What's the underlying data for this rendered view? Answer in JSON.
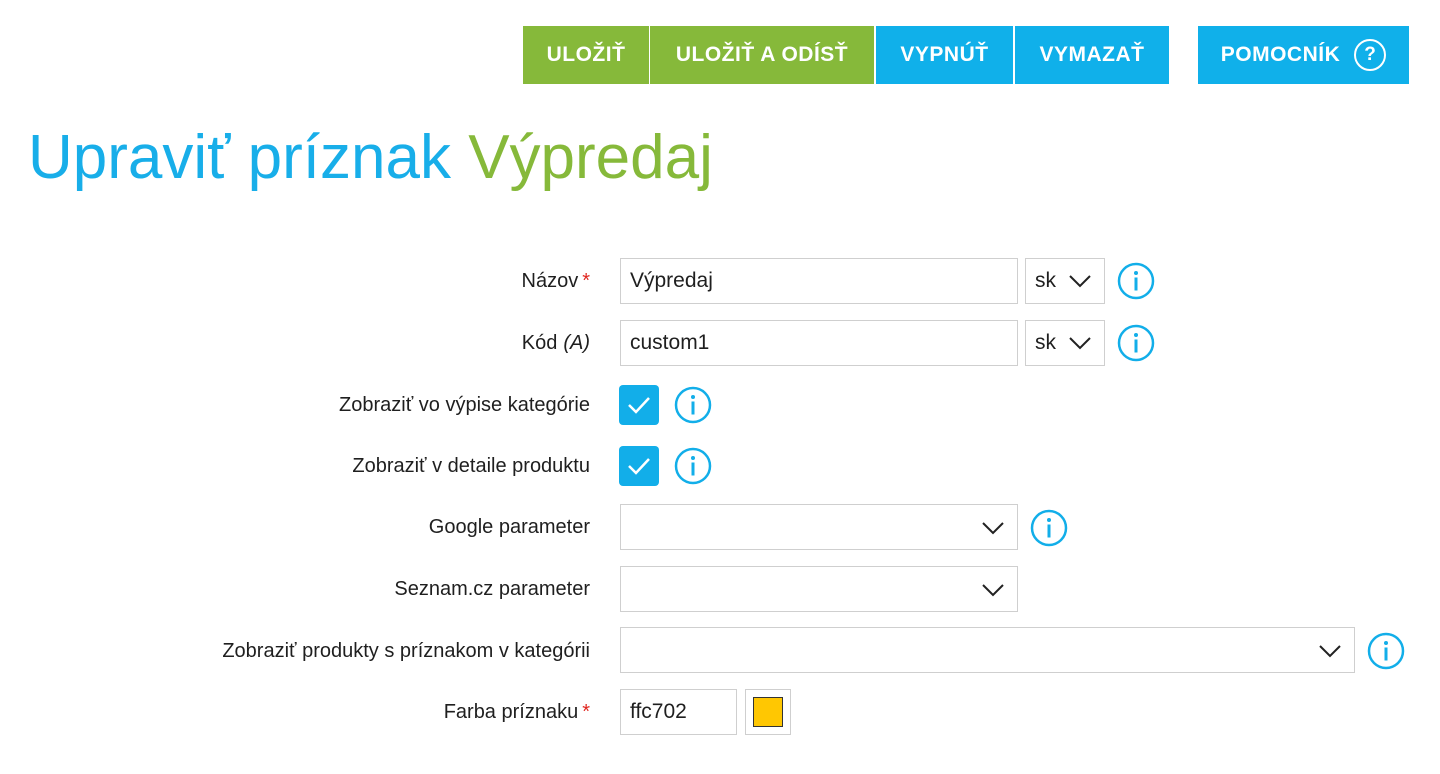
{
  "toolbar": {
    "save_label": "ULOŽIŤ",
    "save_exit_label": "ULOŽIŤ A ODÍSŤ",
    "disable_label": "VYPNÚŤ",
    "delete_label": "VYMAZAŤ",
    "help_label": "POMOCNÍK",
    "help_icon": "?",
    "save_color": "#86b93a",
    "action_color": "#10b0ea"
  },
  "page": {
    "title_prefix": "Upraviť príznak",
    "title_name": "Výpredaj"
  },
  "form": {
    "name": {
      "label": "Názov",
      "required_mark": "*",
      "value": "Výpredaj",
      "lang": "sk",
      "icon": "info-icon"
    },
    "code": {
      "label": "Kód",
      "label_suffix": "(A)",
      "value": "custom1",
      "lang": "sk",
      "icon": "info-icon"
    },
    "show_in_category": {
      "label": "Zobraziť vo výpise kategórie",
      "checked": true,
      "icon": "info-icon"
    },
    "show_in_detail": {
      "label": "Zobraziť v detaile produktu",
      "checked": true,
      "icon": "info-icon"
    },
    "google_parameter": {
      "label": "Google parameter",
      "value": "",
      "icon": "info-icon"
    },
    "seznam_parameter": {
      "label": "Seznam.cz parameter",
      "value": ""
    },
    "category_products": {
      "label": "Zobraziť produkty s príznakom v kategórii",
      "value": "",
      "icon": "info-icon"
    },
    "flag_color": {
      "label": "Farba príznaku",
      "required_mark": "*",
      "value": "ffc702",
      "swatch_color": "#ffc702"
    }
  },
  "colors": {
    "accent_blue": "#12aee9",
    "accent_green": "#86b93a",
    "required_red": "#e0261f"
  }
}
